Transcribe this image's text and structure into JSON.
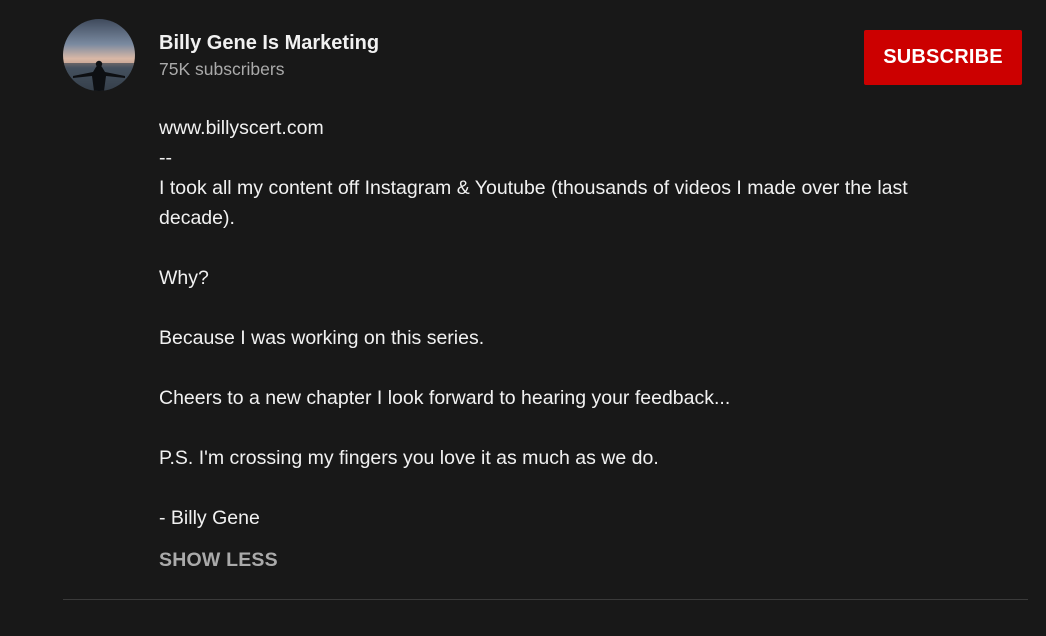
{
  "channel": {
    "name": "Billy Gene Is Marketing",
    "subscribers": "75K subscribers",
    "avatar_icon": "channel-avatar-sunset-silhouette"
  },
  "subscribe": {
    "label": "SUBSCRIBE",
    "color": "#cc0000"
  },
  "description": {
    "link": "www.billyscert.com",
    "separator": "--",
    "para1_line1": "I took all my content off Instagram & Youtube (thousands of videos I made over the last",
    "para1_line2": "decade).",
    "para2": "Why?",
    "para3": "Because I was working on this series.",
    "para4": "Cheers to a new chapter I look forward to hearing your feedback...",
    "para5": "P.S. I'm crossing my fingers you love it as much as we do.",
    "signature": "- Billy Gene"
  },
  "toggle": {
    "show_less_label": "SHOW LESS"
  },
  "theme": {
    "background": "#181818",
    "text_primary": "#f1f1f1",
    "text_secondary": "#aaaaaa"
  }
}
